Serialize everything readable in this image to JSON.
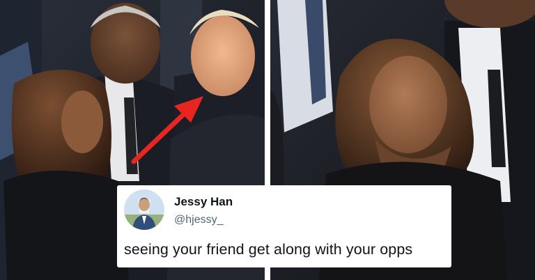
{
  "tweet": {
    "author_name": "Jessy Han",
    "author_handle": "@hjessy_",
    "text": "seeing your friend get along with your opps"
  },
  "annotation": {
    "arrow_color": "#e8261f"
  },
  "icons": {
    "avatar": "avatar-photo-icon",
    "arrow": "red-arrow-icon"
  }
}
